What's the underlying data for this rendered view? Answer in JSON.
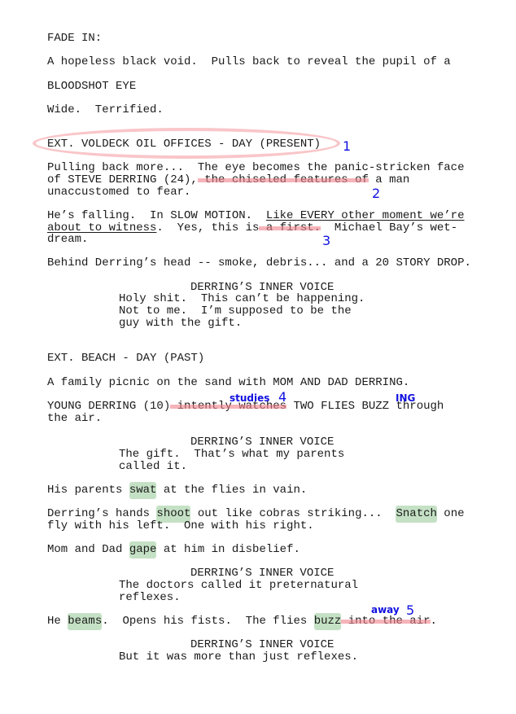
{
  "lines": [
    [
      {
        "t": "FADE IN:"
      }
    ],
    [
      {
        "t": "A hopeless black void.  Pulls back to reveal the pupil of a"
      }
    ],
    [
      {
        "t": "BLOODSHOT EYE"
      }
    ],
    [
      {
        "t": "Wide.  Terrified."
      }
    ],
    [
      {
        "t": "EXT. VOLDECK OIL OFFICES - DAY (PRESENT)"
      }
    ],
    [
      {
        "t": "Pulling back more...  The eye becomes the panic-stricken face"
      }
    ],
    [
      {
        "t": "of STEVE DERRING (24),"
      },
      {
        "t": " the chiseled features of",
        "s": "strike"
      },
      {
        "t": " a man"
      }
    ],
    [
      {
        "t": "unaccustomed to fear."
      }
    ],
    [
      {
        "t": "He’s falling.  In SLOW MOTION.  "
      },
      {
        "t": "Like EVERY other moment we’re",
        "s": "under"
      }
    ],
    [
      {
        "t": "about to witness",
        "s": "under"
      },
      {
        "t": ".  Yes, this is"
      },
      {
        "t": " a first.",
        "s": "strike"
      },
      {
        "t": "  Michael Bay’s wet-"
      }
    ],
    [
      {
        "t": "dream."
      }
    ],
    [
      {
        "t": "Behind Derring’s head -- smoke, debris... and a 20 STORY DROP."
      }
    ],
    [
      {
        "t": "DERRING’S INNER VOICE"
      }
    ],
    [
      {
        "t": "Holy shit.  This can’t be happening."
      }
    ],
    [
      {
        "t": "Not to me.  I’m supposed to be the"
      }
    ],
    [
      {
        "t": "guy with the gift."
      }
    ],
    [
      {
        "t": "EXT. BEACH - DAY (PAST)"
      }
    ],
    [
      {
        "t": "A family picnic on the sand with MOM AND DAD DERRING."
      }
    ],
    [
      {
        "t": "YOUNG DERRING (10)"
      },
      {
        "t": " intently watches",
        "s": "strike"
      },
      {
        "t": " TWO FLIES BUZZ through"
      }
    ],
    [
      {
        "t": "the air."
      }
    ],
    [
      {
        "t": "DERRING’S INNER VOICE"
      }
    ],
    [
      {
        "t": "The gift.  That’s what my parents"
      }
    ],
    [
      {
        "t": "called it."
      }
    ],
    [
      {
        "t": "His parents "
      },
      {
        "t": "swat",
        "s": "hl"
      },
      {
        "t": " at the flies in vain."
      }
    ],
    [
      {
        "t": "Derring’s hands "
      },
      {
        "t": "shoot",
        "s": "hl"
      },
      {
        "t": " out like cobras striking...  "
      },
      {
        "t": "Snatch",
        "s": "hl"
      },
      {
        "t": " one"
      }
    ],
    [
      {
        "t": "fly with his left.  One with his right."
      }
    ],
    [
      {
        "t": "Mom and Dad "
      },
      {
        "t": "gape",
        "s": "hl"
      },
      {
        "t": " at him in disbelief."
      }
    ],
    [
      {
        "t": "DERRING’S INNER VOICE"
      }
    ],
    [
      {
        "t": "The doctors called it preternatural"
      }
    ],
    [
      {
        "t": "reflexes."
      }
    ],
    [
      {
        "t": "He "
      },
      {
        "t": "beams",
        "s": "hl"
      },
      {
        "t": ".  Opens his fists.  The flies "
      },
      {
        "t": "buzz",
        "s": "hl"
      },
      {
        "t": " into the air",
        "s": "strike"
      },
      {
        "t": "."
      }
    ],
    [
      {
        "t": "DERRING’S INNER VOICE"
      }
    ],
    [
      {
        "t": "But it was more than just reflexes."
      }
    ]
  ],
  "annotations": [
    {
      "label": "1",
      "kind": "num"
    },
    {
      "label": "2",
      "kind": "num"
    },
    {
      "label": "3",
      "kind": "num"
    },
    {
      "label": "studies",
      "kind": "word"
    },
    {
      "label": "4",
      "kind": "num"
    },
    {
      "label": "ING",
      "kind": "word"
    },
    {
      "label": "away",
      "kind": "word"
    },
    {
      "label": "5",
      "kind": "num"
    }
  ],
  "colors": {
    "annotation": "#1010e0",
    "strike": "#f0828c",
    "highlight": "#96c896",
    "circle": "#f5a0a5"
  }
}
